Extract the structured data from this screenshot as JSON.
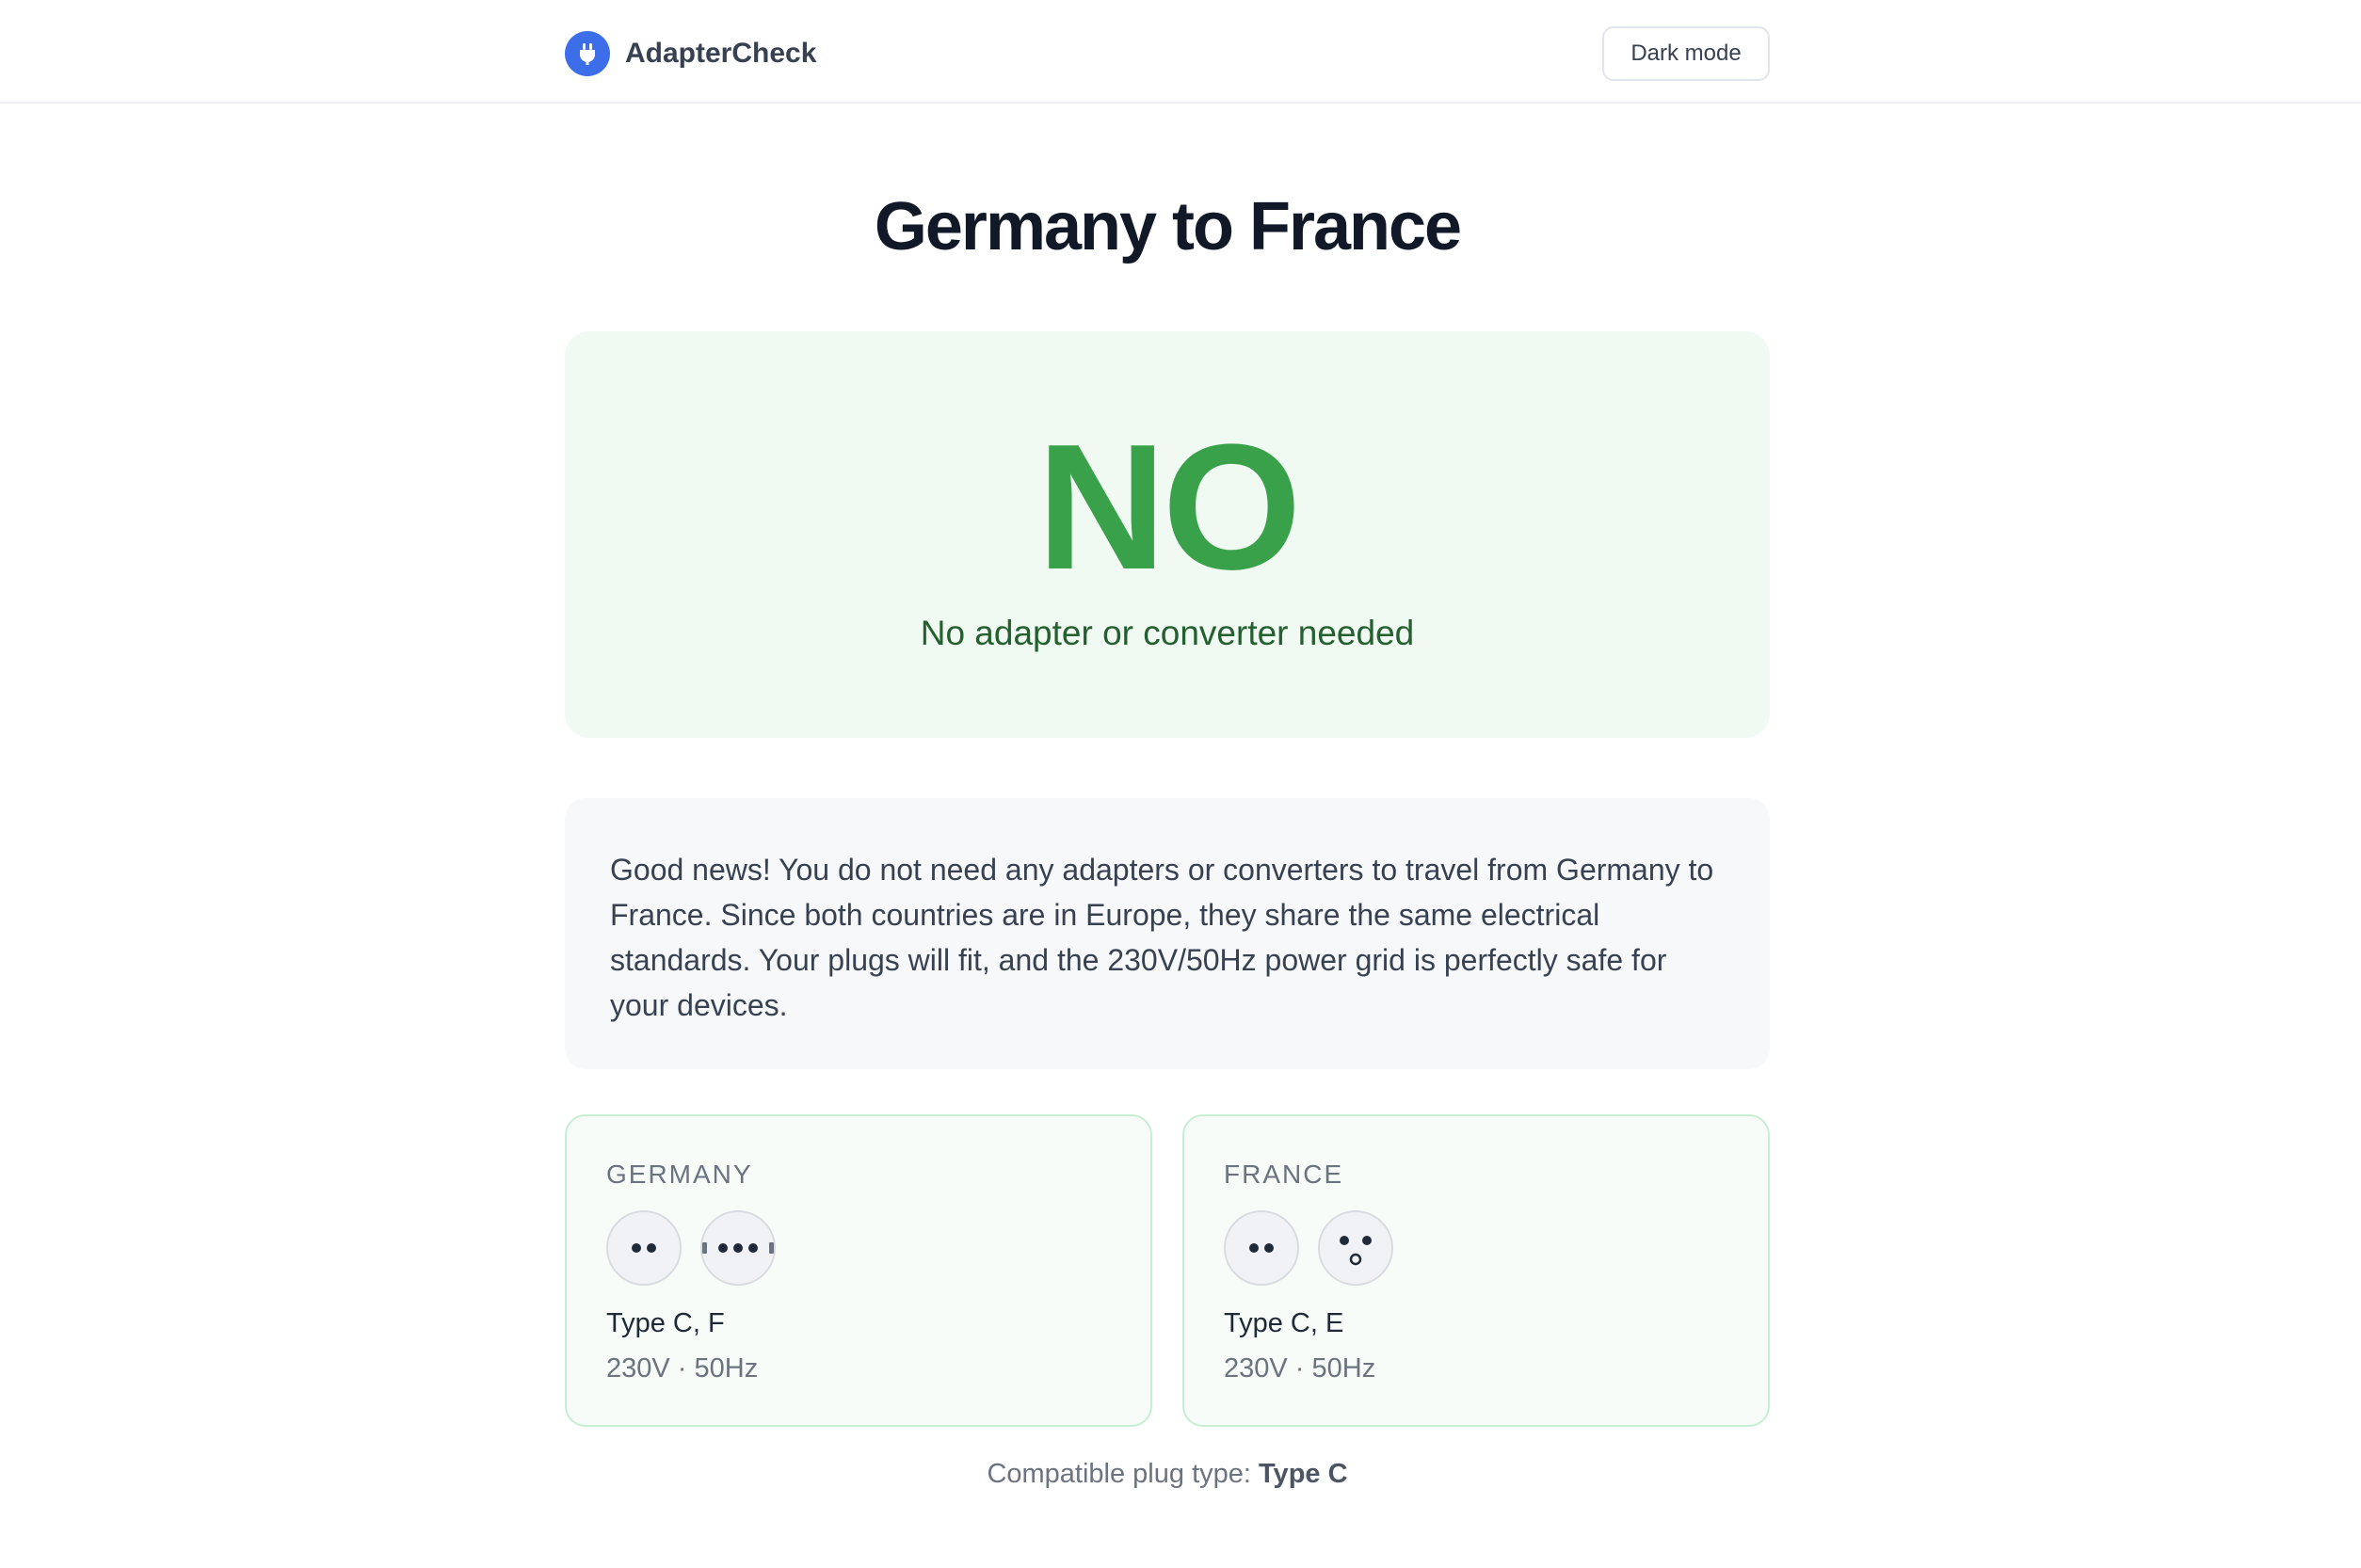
{
  "header": {
    "brand_name": "AdapterCheck",
    "brand_icon": "plug-icon",
    "dark_mode_label": "Dark mode"
  },
  "title": "Germany to France",
  "verdict": {
    "word": "NO",
    "subtitle": "No adapter or converter needed",
    "color": "#3aa14b"
  },
  "info_text": "Good news! You do not need any adapters or converters to travel from Germany to France. Since both countries are in Europe, they share the same electrical standards. Your plugs will fit, and the 230V/50Hz power grid is perfectly safe for your devices.",
  "countries": [
    {
      "name": "GERMANY",
      "plug_icons": [
        "type-c-plug-icon",
        "type-f-plug-icon"
      ],
      "types": "Type C, F",
      "electrical": "230V · 50Hz"
    },
    {
      "name": "FRANCE",
      "plug_icons": [
        "type-c-plug-icon",
        "type-e-plug-icon"
      ],
      "types": "Type C, E",
      "electrical": "230V · 50Hz"
    }
  ],
  "compatible": {
    "label": "Compatible plug type:",
    "value": "Type C"
  }
}
